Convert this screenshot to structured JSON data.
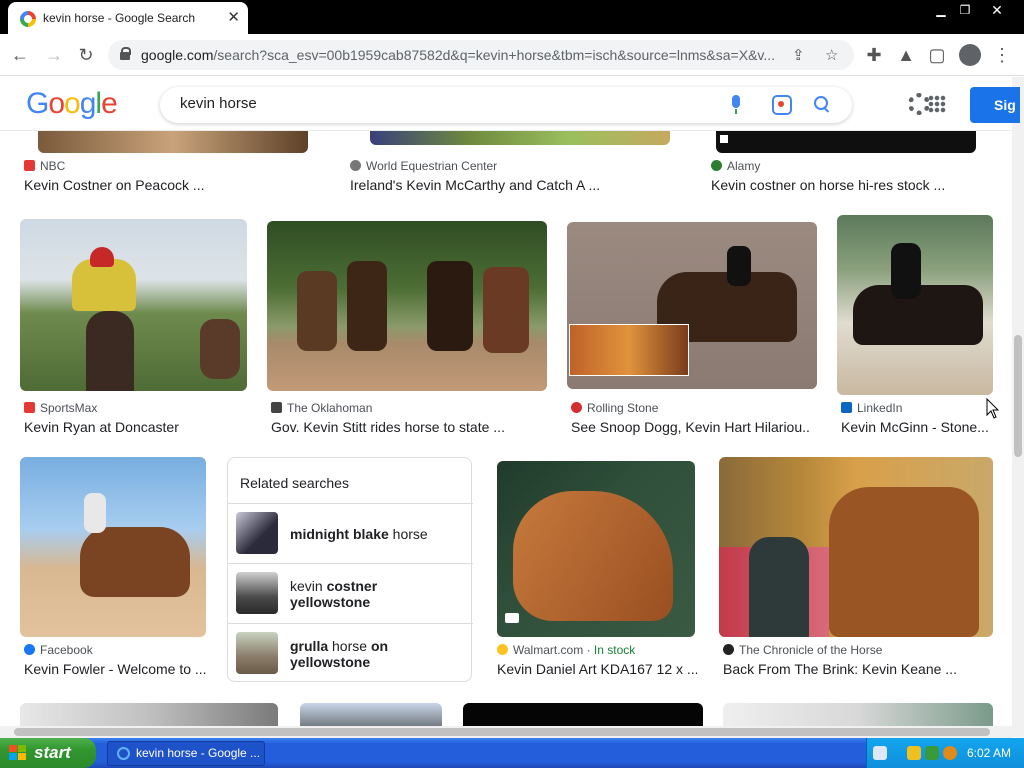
{
  "browser": {
    "tab_title": "kevin horse - Google Search",
    "url_host": "google.com",
    "url_rest": "/search?sca_esv=00b1959cab87582d&q=kevin+horse&tbm=isch&source=lnms&sa=X&v..."
  },
  "google": {
    "logo": [
      "G",
      "o",
      "o",
      "g",
      "l",
      "e"
    ],
    "query": "kevin horse",
    "signin_label": "Sig"
  },
  "results": [
    {
      "source": "NBC",
      "caption": "Kevin Costner on Peacock ...",
      "icon_color": "#e53935"
    },
    {
      "source": "World Equestrian Center",
      "caption": "Ireland's Kevin McCarthy and Catch A ...",
      "icon_color": "#777777"
    },
    {
      "source": "Alamy",
      "caption": "Kevin costner on horse hi-res stock ...",
      "icon_color": "#2e7d32"
    },
    {
      "source": "SportsMax",
      "caption": "Kevin Ryan at Doncaster",
      "icon_color": "#e53935"
    },
    {
      "source": "The Oklahoman",
      "caption": "Gov. Kevin Stitt rides horse to state ...",
      "icon_color": "#444444"
    },
    {
      "source": "Rolling Stone",
      "caption": "See Snoop Dogg, Kevin Hart Hilariou...",
      "icon_color": "#d32f2f"
    },
    {
      "source": "LinkedIn",
      "caption": "Kevin McGinn - Stone...",
      "icon_color": "#0a66c2"
    },
    {
      "source": "Facebook",
      "caption": "Kevin Fowler - Welcome to ...",
      "icon_color": "#1877f2"
    },
    {
      "source": "Walmart.com",
      "stock": "In stock",
      "caption": "Kevin Daniel Art KDA167 12 x ...",
      "icon_color": "#ffc220"
    },
    {
      "source": "The Chronicle of the Horse",
      "caption": "Back From The Brink: Kevin Keane ...",
      "icon_color": "#222222"
    }
  ],
  "related": {
    "title": "Related searches",
    "items": [
      {
        "bold1": "midnight blake",
        "plain1": " horse",
        "bold2": "",
        "plain2": ""
      },
      {
        "bold1": "",
        "plain1": "kevin ",
        "bold2": "costner yellowstone",
        "plain2": ""
      },
      {
        "bold1": "grulla",
        "plain1": " horse ",
        "bold2": "on yellowstone",
        "plain2": ""
      }
    ]
  },
  "taskbar": {
    "start_label": "start",
    "task_label": "kevin horse - Google ...",
    "clock": "6:02 AM"
  },
  "colors": {
    "google_blue": "#4285f4",
    "signin_blue": "#1a73e8",
    "xp_taskbar": "#245edb",
    "xp_start_green": "#32962f"
  }
}
